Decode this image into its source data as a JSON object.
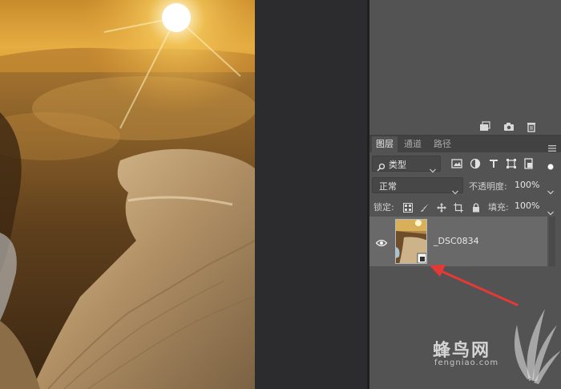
{
  "panel": {
    "tabs": [
      {
        "label": "图层",
        "active": true
      },
      {
        "label": "通道",
        "active": false
      },
      {
        "label": "路径",
        "active": false
      }
    ],
    "filter": {
      "kind_label": "类型"
    },
    "blend_mode": "正常",
    "opacity": {
      "label": "不透明度:",
      "value": "100%"
    },
    "lock": {
      "label": "锁定:"
    },
    "fill": {
      "label": "填充:",
      "value": "100%"
    },
    "layers": [
      {
        "name": "_DSC0834",
        "visible": true,
        "type": "smart-object"
      }
    ],
    "upper_toolbar_icons": [
      "new-from-capture-icon",
      "camera-icon",
      "trash-icon"
    ],
    "filter_icons": [
      "image-icon",
      "adjustment-icon",
      "type-icon",
      "shape-icon",
      "smart-object-icon"
    ],
    "lock_icons": [
      "lock-pixels-icon",
      "brush-icon",
      "move-icon",
      "artboard-icon",
      "lock-icon"
    ]
  },
  "watermark": {
    "text": "蜂鸟网",
    "subtext": "fengniao.com"
  },
  "colors": {
    "panel_bg": "#535353",
    "selected_layer": "#696969",
    "annotation_arrow": "#e53935"
  }
}
